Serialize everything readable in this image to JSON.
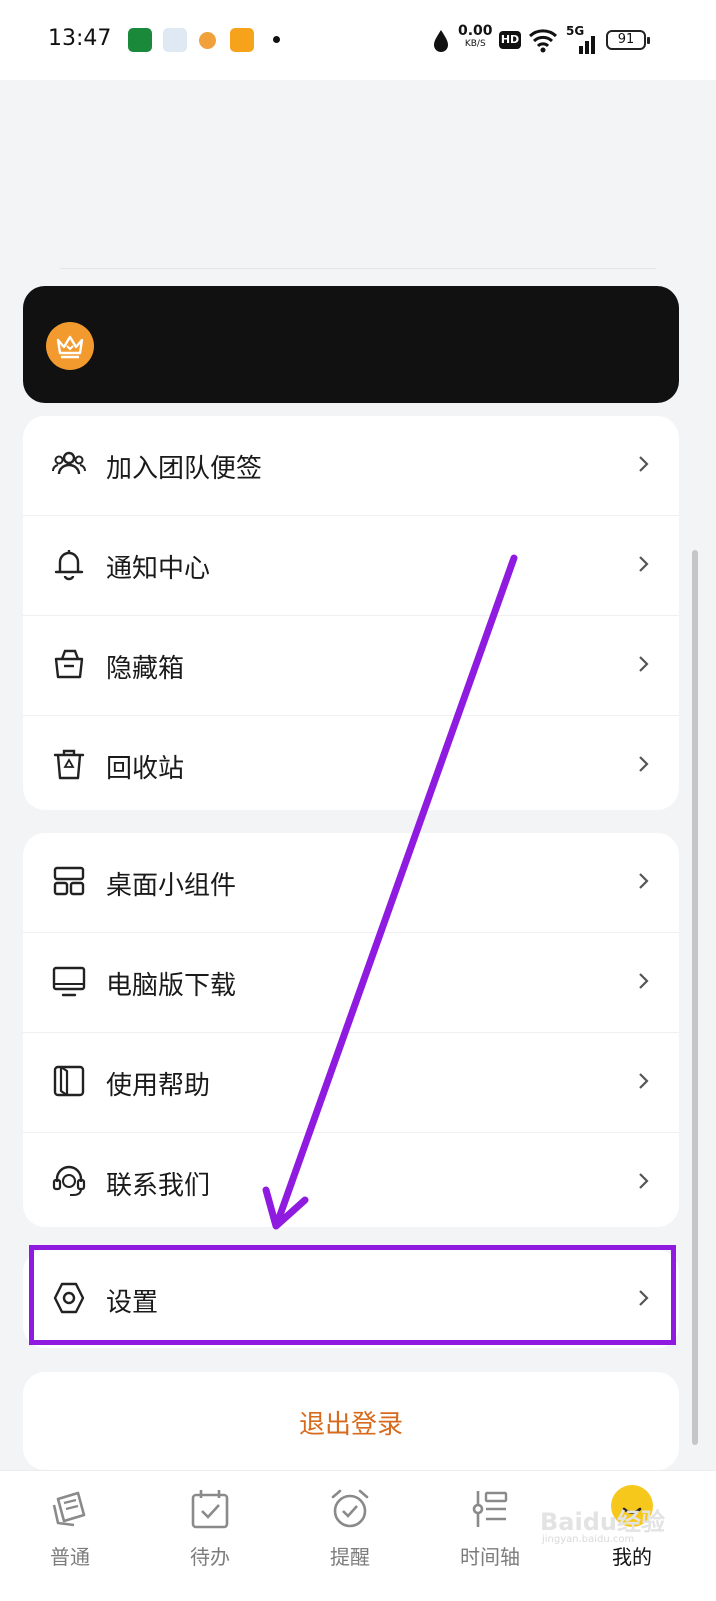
{
  "status_bar": {
    "time": "13:47",
    "net_speed_value": "0.00",
    "net_speed_unit": "KB/S",
    "hd_badge": "HD",
    "network_type": "5G",
    "battery_level": "91",
    "icons": [
      "oppo-app-icon",
      "sailboat-app-icon",
      "orange-app-icon",
      "video-player-app-icon",
      "notification-dot",
      "water-drop-icon",
      "wifi-icon",
      "signal-icon",
      "battery-icon"
    ]
  },
  "vip_banner": {
    "icon": "crown-icon",
    "badge_color": "#f39a2f"
  },
  "menu_group_1": [
    {
      "label": "加入团队便签",
      "icon": "team-icon"
    },
    {
      "label": "通知中心",
      "icon": "bell-icon"
    },
    {
      "label": "隐藏箱",
      "icon": "hidden-box-icon"
    },
    {
      "label": "回收站",
      "icon": "recycle-bin-icon"
    }
  ],
  "menu_group_2": [
    {
      "label": "桌面小组件",
      "icon": "widget-icon"
    },
    {
      "label": "电脑版下载",
      "icon": "desktop-icon"
    },
    {
      "label": "使用帮助",
      "icon": "book-icon"
    },
    {
      "label": "联系我们",
      "icon": "headset-icon"
    }
  ],
  "settings": {
    "label": "设置",
    "icon": "settings-icon"
  },
  "logout": {
    "label": "退出登录",
    "color": "#d86a1c"
  },
  "tabs": [
    {
      "label": "普通",
      "icon": "note-icon"
    },
    {
      "label": "待办",
      "icon": "todo-calendar-icon"
    },
    {
      "label": "提醒",
      "icon": "alarm-clock-icon"
    },
    {
      "label": "时间轴",
      "icon": "timeline-icon"
    },
    {
      "label": "我的",
      "icon": "profile-avatar-icon",
      "active": true
    }
  ],
  "annotation": {
    "highlight_color": "#8f1be0"
  },
  "watermark": {
    "text": "Baidu经验",
    "sub": "jingyan.baidu.com"
  }
}
